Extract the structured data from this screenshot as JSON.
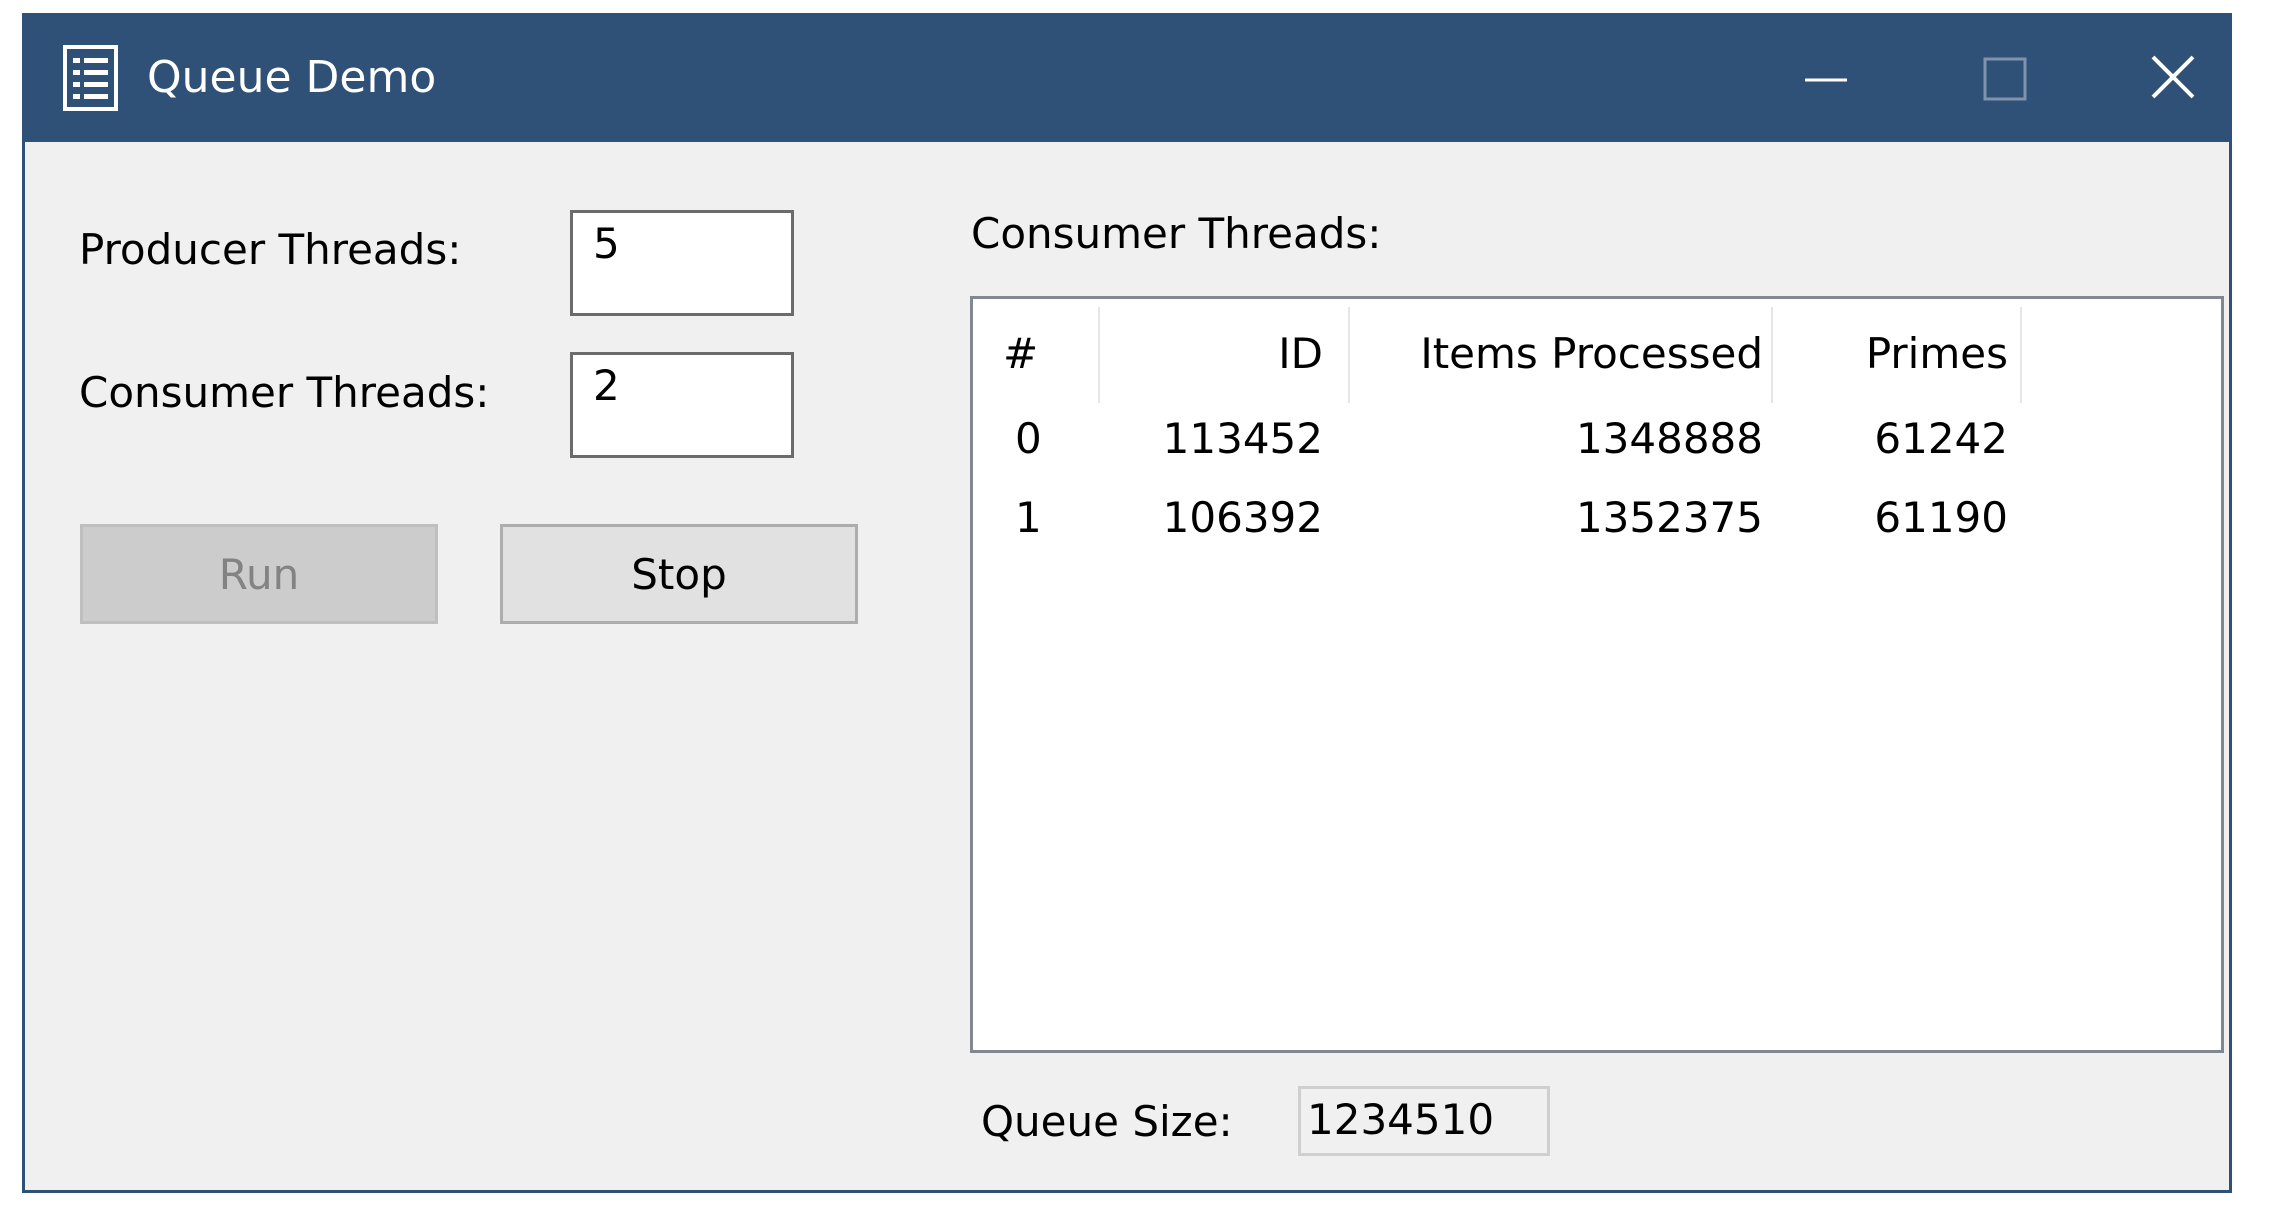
{
  "window": {
    "title": "Queue Demo",
    "colors": {
      "titlebar": "#2f5178",
      "client": "#f0f0f0"
    },
    "icons": {
      "app": "list-document-icon",
      "minimize": "minimize-icon",
      "maximize": "maximize-icon",
      "close": "close-icon"
    }
  },
  "settings": {
    "producer_label": "Producer Threads:",
    "producer_value": "5",
    "consumer_label": "Consumer Threads:",
    "consumer_value": "2"
  },
  "buttons": {
    "run_label": "Run",
    "run_enabled": false,
    "stop_label": "Stop"
  },
  "consumers": {
    "heading": "Consumer Threads:",
    "columns": [
      "#",
      "ID",
      "Items Processed",
      "Primes"
    ],
    "rows": [
      {
        "index": "0",
        "id": "113452",
        "items": "1348888",
        "primes": "61242"
      },
      {
        "index": "1",
        "id": "106392",
        "items": "1352375",
        "primes": "61190"
      }
    ]
  },
  "queue": {
    "label": "Queue Size:",
    "value": "1234510"
  }
}
